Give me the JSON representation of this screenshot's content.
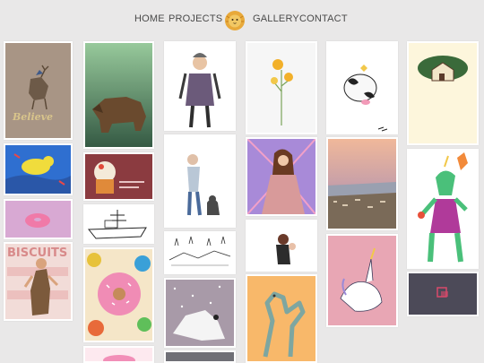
{
  "nav": {
    "home": "HOME",
    "projects": "PROJECTS",
    "gallery": "GALLERY",
    "contact": "CONTACT",
    "logo_icon": "lion-face-logo-icon"
  },
  "artworks": {
    "deer_caption": "Believe",
    "biscuits_title": "BISCUITS"
  }
}
